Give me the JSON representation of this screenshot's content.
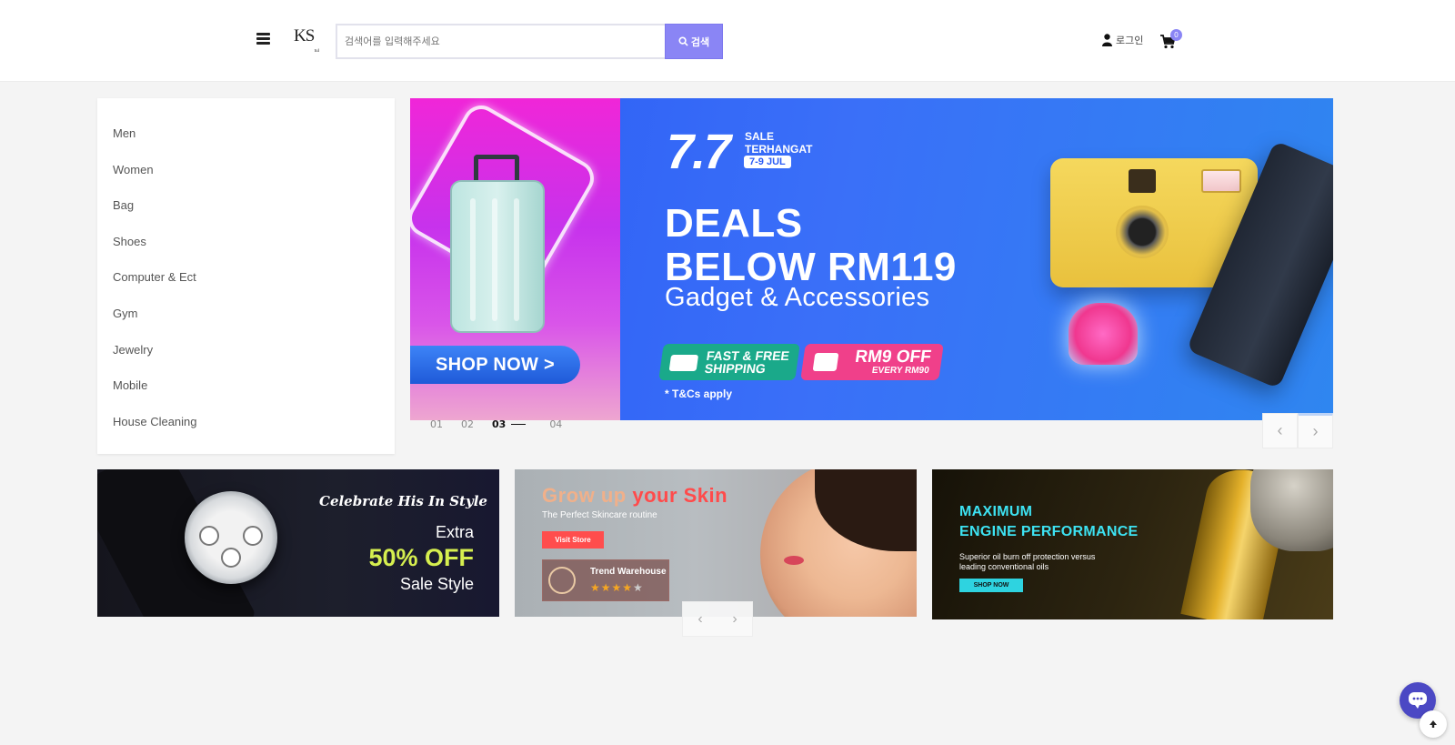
{
  "header": {
    "logo_text": "KS",
    "logo_subtext": "tul",
    "search_placeholder": "검색어를 입력해주세요",
    "search_button_label": "검색",
    "login_label": "로그인",
    "cart_count": "0"
  },
  "sidebar": {
    "items": [
      {
        "label": "Men"
      },
      {
        "label": "Women"
      },
      {
        "label": "Bag"
      },
      {
        "label": "Shoes"
      },
      {
        "label": "Computer & Ect"
      },
      {
        "label": "Gym"
      },
      {
        "label": "Jewelry"
      },
      {
        "label": "Mobile"
      },
      {
        "label": "House Cleaning"
      }
    ]
  },
  "hero": {
    "shop_now": "SHOP NOW >",
    "sale_number": "7.7",
    "sale_line1": "SALE",
    "sale_line2": "TERHANGAT",
    "sale_dates": "7-9 JUL",
    "headline_line1": "DEALS",
    "headline_line2": "BELOW RM119",
    "headline_sub": "Gadget & Accessories",
    "shipping_line1": "FAST & FREE",
    "shipping_line2": "SHIPPING",
    "off_title": "RM9 OFF",
    "off_sub": "EVERY RM90",
    "tnc": "* T&Cs apply",
    "slides": [
      "01",
      "02",
      "03",
      "04"
    ],
    "active_slide": "03",
    "prev_arrow": "‹",
    "next_arrow": "›"
  },
  "promos": {
    "watch": {
      "script": "Celebrate His In Style",
      "extra": "Extra",
      "percent": "50% OFF",
      "style": "Sale Style"
    },
    "skin": {
      "title_part1": "Grow up ",
      "title_part2": "your Skin",
      "subtitle": "The Perfect Skincare routine",
      "visit_button": "Visit Store",
      "store_name": "Trend Warehouse",
      "rating": 4,
      "rating_max": 5,
      "stars_filled": "★★★★",
      "stars_empty": "★",
      "prev_arrow": "‹",
      "next_arrow": "›"
    },
    "oil": {
      "title_line1": "MAXIMUM",
      "title_line2": "ENGINE PERFORMANCE",
      "sub_line1": "Superior oil burn off protection versus",
      "sub_line2": "leading conventional oils",
      "shop_button": "SHOP NOW"
    }
  },
  "colors": {
    "accent": "#8a85f5",
    "chat": "#4b48c4",
    "hero_blue": "#2b5cf5",
    "hero_pink": "#f026d8"
  }
}
